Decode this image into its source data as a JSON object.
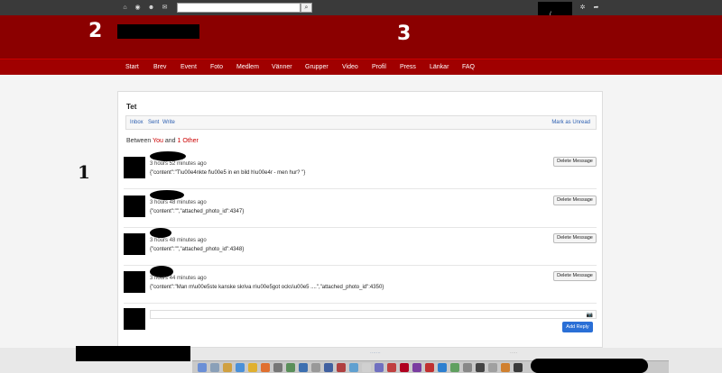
{
  "toolbar": {
    "icons": [
      "home-icon",
      "globe-icon",
      "users-icon",
      "mail-icon",
      "gear-icon",
      "logout-icon"
    ],
    "search_placeholder": "",
    "search_icon": "🔍",
    "user_mark": "/"
  },
  "header": {
    "label_left": "2",
    "label_right": "3"
  },
  "nav": {
    "items": [
      "Start",
      "Brev",
      "Event",
      "Foto",
      "Medlem",
      "Vänner",
      "Grupper",
      "Video",
      "Profil",
      "Press",
      "Länkar",
      "FAQ"
    ]
  },
  "side_label": "1",
  "conversation": {
    "title": "Tet",
    "tabs": [
      "Inbox",
      "Sent",
      "Write"
    ],
    "mark_unread": "Mark as Unread",
    "between_prefix": "Between",
    "between_you": "You",
    "between_and": "and",
    "between_other": "1 Other",
    "messages": [
      {
        "time": "3 hours 52 minutes ago",
        "content": "{\"content\":\"T\\u00e4nkte f\\u00e5 in en bild h\\u00e4r - men hur? \"}",
        "action": "Delete Message"
      },
      {
        "time": "3 hours 48 minutes ago",
        "content": "{\"content\":\"\",\"attached_photo_id\":4347}",
        "action": "Delete Message"
      },
      {
        "time": "3 hours 48 minutes ago",
        "content": "{\"content\":\"\",\"attached_photo_id\":4348}",
        "action": "Delete Message"
      },
      {
        "time": "3 hours 44 minutes ago",
        "content": "{\"content\":\"Man m\\u00e5ste kanske skriva n\\u00e5got ocks\\u00e5 ....\",\"attached_photo_id\":4350}",
        "action": "Delete Message"
      }
    ],
    "reply_placeholder": "",
    "reply_button": "Add Reply",
    "camera_icon": "📷"
  },
  "colors": {
    "header": "#8b0000",
    "nav": "#a00000",
    "accent_link": "#2a5db0",
    "reply_button": "#2a6fd6"
  }
}
